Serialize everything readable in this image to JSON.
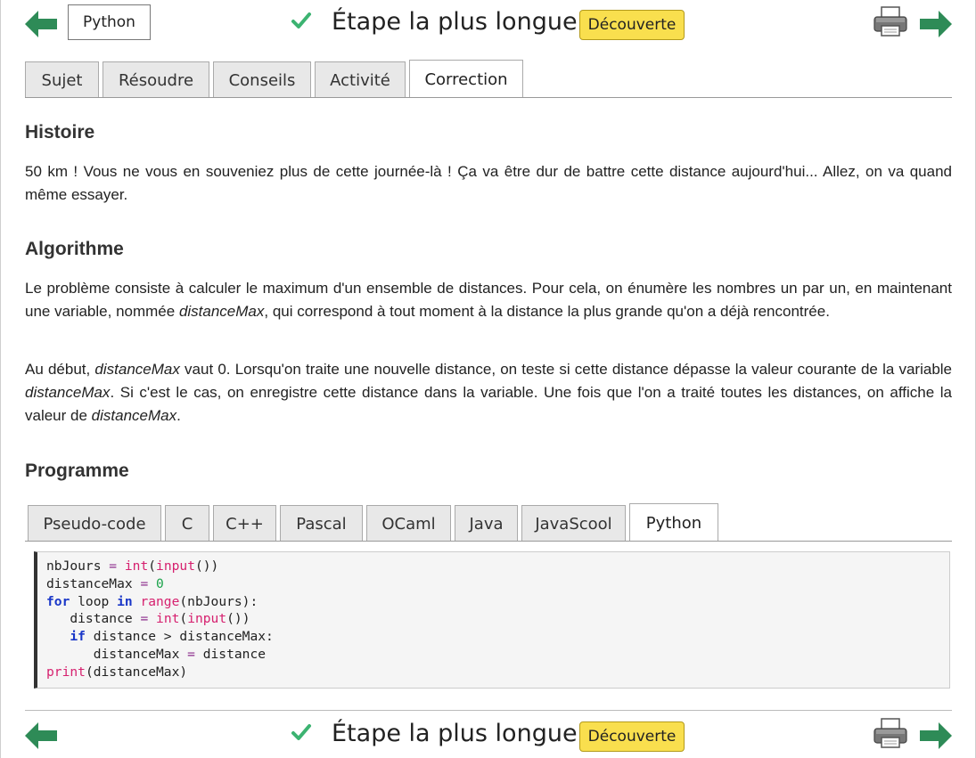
{
  "header": {
    "language_button": "Python",
    "title": "Étape la plus longue",
    "badge": "Découverte"
  },
  "main_tabs": [
    "Sujet",
    "Résoudre",
    "Conseils",
    "Activité",
    "Correction"
  ],
  "active_main_tab": "Correction",
  "sections": {
    "histoire_title": "Histoire",
    "histoire_text": "50 km ! Vous ne vous en souveniez plus de cette journée-là ! Ça va être dur de battre cette distance aujourd'hui... Allez, on va quand même essayer.",
    "algorithme_title": "Algorithme",
    "algo_p1": [
      "Le problème consiste à calculer le maximum d'un ensemble de distances. Pour cela, on énumère les nombres un par un, en maintenant une variable, nommée ",
      "distanceMax",
      ", qui correspond à tout moment à la distance la plus grande qu'on a déjà rencontrée."
    ],
    "algo_p2": [
      "Au début, ",
      "distanceMax",
      " vaut 0. Lorsqu'on traite une nouvelle distance, on teste si cette distance dépasse la valeur courante de la variable ",
      "distanceMax",
      ". Si c'est le cas, on enregistre cette distance dans la variable. Une fois que l'on a traité toutes les distances, on affiche la valeur de ",
      "distanceMax",
      "."
    ],
    "programme_title": "Programme"
  },
  "code_tabs": [
    "Pseudo-code",
    "C",
    "C++",
    "Pascal",
    "OCaml",
    "Java",
    "JavaScool",
    "Python"
  ],
  "active_code_tab": "Python",
  "code_lines": [
    "nbJours = int(input())",
    "distanceMax = 0",
    "for loop in range(nbJours):",
    "   distance = int(input())",
    "   if distance > distanceMax:",
    "      distanceMax = distance",
    "print(distanceMax)"
  ],
  "icons": {
    "prev": "arrow-left-icon",
    "next": "arrow-right-icon",
    "done": "check-icon",
    "print": "printer-icon"
  },
  "colors": {
    "arrow": "#2e8b57",
    "check": "#3cb371",
    "badge": "#f9df4e"
  }
}
